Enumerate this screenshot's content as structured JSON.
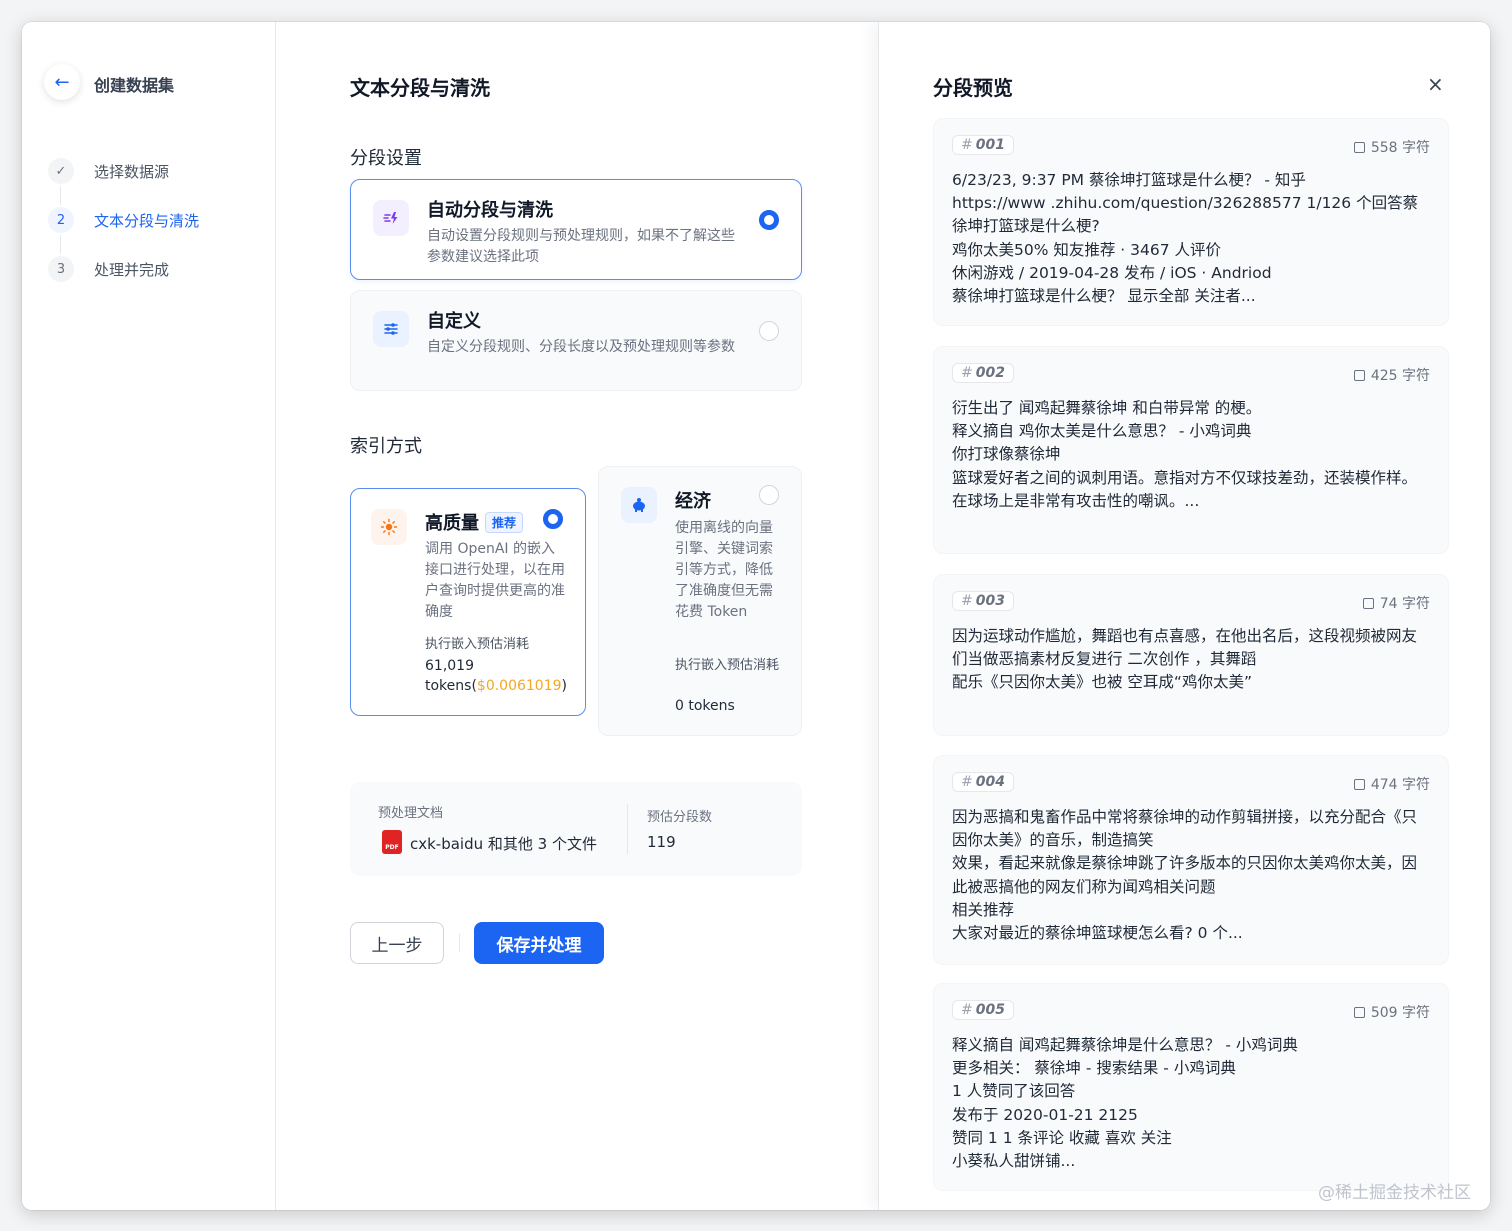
{
  "sidebar": {
    "title": "创建数据集",
    "steps": [
      {
        "index": "✓",
        "label": "选择数据源"
      },
      {
        "index": "2",
        "label": "文本分段与清洗"
      },
      {
        "index": "3",
        "label": "处理并完成"
      }
    ]
  },
  "main": {
    "title": "文本分段与清洗",
    "segment_section": "分段设置",
    "segment_options": [
      {
        "name": "自动分段与清洗",
        "desc": "自动设置分段规则与预处理规则，如果不了解这些参数建议选择此项",
        "selected": true
      },
      {
        "name": "自定义",
        "desc": "自定义分段规则、分段长度以及预处理规则等参数",
        "selected": false
      }
    ],
    "index_section": "索引方式",
    "index_options": {
      "high": {
        "name": "高质量",
        "badge": "推荐",
        "desc": "调用 OpenAI 的嵌入接口进行处理，以在用户查询时提供更高的准确度",
        "cost_label": "执行嵌入预估消耗",
        "cost_value": "61,019",
        "cost_unit": "tokens(",
        "cost_price": "$0.0061019",
        "cost_close": ")"
      },
      "eco": {
        "name": "经济",
        "desc": "使用离线的向量引擎、关键词索引等方式，降低了准确度但无需花费 Token",
        "cost_label": "执行嵌入预估消耗",
        "cost_value": "0 tokens"
      }
    },
    "summary": {
      "doc_label": "预处理文档",
      "doc_value": "cxk-baidu 和其他 3 个文件",
      "seg_label": "预估分段数",
      "seg_value": "119"
    },
    "buttons": {
      "prev": "上一步",
      "save": "保存并处理"
    }
  },
  "preview": {
    "title": "分段预览",
    "close": "×",
    "chunks": [
      {
        "id": "001",
        "chars": "558 字符",
        "text": "6/23/23, 9:37 PM 蔡徐坤打篮球是什么梗？ - 知乎\nhttps://www .zhihu.com/question/326288577 1/126 个回答蔡徐坤打篮球是什么梗?\n鸡你太美50% 知友推荐 · 3467 人评价\n休闲游戏 / 2019-04-28 发布 / iOS · Andriod\n蔡徐坤打篮球是什么梗？ 显示全部 关注者..."
      },
      {
        "id": "002",
        "chars": "425 字符",
        "text": "衍生出了 闻鸡起舞蔡徐坤 和白带异常 的梗。\n释义摘自 鸡你太美是什么意思？ - 小鸡词典\n你打球像蔡徐坤\n篮球爱好者之间的讽刺用语。意指对方不仅球技差劲，还装模作样。在球场上是非常有攻击性的嘲讽。..."
      },
      {
        "id": "003",
        "chars": "74 字符",
        "text": "因为运球动作尴尬，舞蹈也有点喜感，在他出名后，这段视频被网友们当做恶搞素材反复进行 二次创作 ，其舞蹈\n配乐《只因你太美》也被 空耳成“鸡你太美”"
      },
      {
        "id": "004",
        "chars": "474 字符",
        "text": "因为恶搞和鬼畜作品中常将蔡徐坤的动作剪辑拼接，以充分配合《只因你太美》的音乐，制造搞笑\n效果，看起来就像是蔡徐坤跳了许多版本的只因你太美鸡你太美，因此被恶搞他的网友们称为闻鸡相关问题\n相关推荐\n大家对最近的蔡徐坤篮球梗怎么看? 0 个..."
      },
      {
        "id": "005",
        "chars": "509 字符",
        "text": "释义摘自 闻鸡起舞蔡徐坤是什么意思？ - 小鸡词典\n更多相关： 蔡徐坤 - 搜索结果 - 小鸡词典\n1 人赞同了该回答\n发布于 2020-01-21 2125\n赞同 1 1 条评论 收藏 喜欢 关注\n小葵私人甜饼铺..."
      }
    ]
  },
  "watermark": "@稀土掘金技术社区",
  "colors": {
    "accent": "#1c64f2",
    "price": "#f5a623"
  }
}
